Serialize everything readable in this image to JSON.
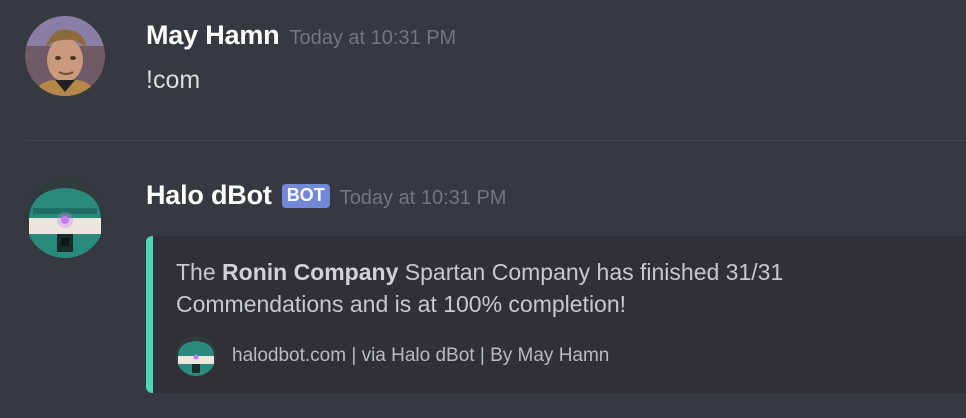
{
  "messages": [
    {
      "username": "May Hamn",
      "timestamp": "Today at 10:31 PM",
      "content": "!com",
      "avatar_icon": "user-portrait-avatar"
    },
    {
      "username": "Halo dBot",
      "badge": "BOT",
      "timestamp": "Today at 10:31 PM",
      "avatar_icon": "halo-helmet-avatar",
      "embed": {
        "accent_color": "#4fd6b4",
        "desc_prefix": "The ",
        "desc_bold": "Ronin Company",
        "desc_line1_rest": " Spartan Company has finished 31/31",
        "desc_line2": "Commendations and is at 100% completion!",
        "footer_text": "halodbot.com | via Halo dBot | By May Hamn",
        "footer_icon": "halo-helmet-icon"
      }
    }
  ],
  "colors": {
    "background": "#36393f",
    "embed_background": "#2f3136",
    "bot_badge": "#7289da",
    "timestamp": "#72767d"
  }
}
